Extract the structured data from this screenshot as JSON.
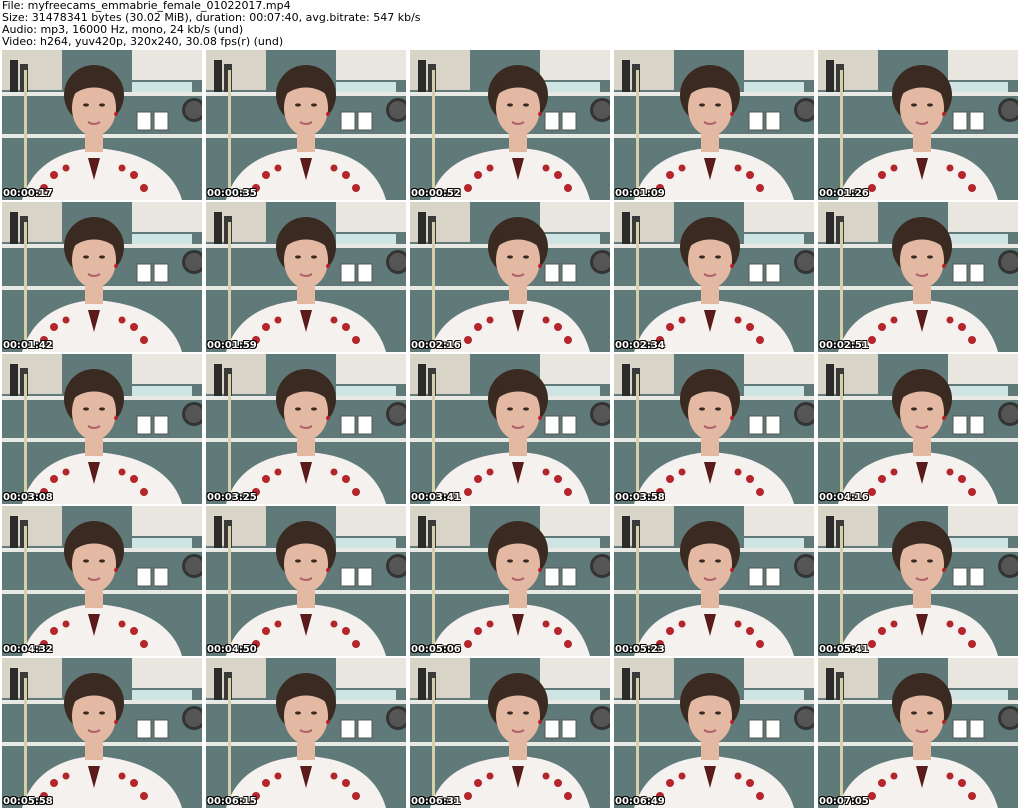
{
  "header": {
    "file": "File: myfreecams_emmabrie_female_01022017.mp4",
    "size": "Size: 31478341 bytes (30.02 MiB), duration: 00:07:40, avg.bitrate: 547 kb/s",
    "audio": "Audio: mp3, 16000 Hz, mono, 24 kb/s (und)",
    "video": "Video: h264, yuv420p, 320x240, 30.08 fps(r) (und)"
  },
  "thumbnails": [
    "00:00:17",
    "00:00:35",
    "00:00:52",
    "00:01:09",
    "00:01:26",
    "00:01:42",
    "00:01:59",
    "00:02:16",
    "00:02:34",
    "00:02:51",
    "00:03:08",
    "00:03:25",
    "00:03:41",
    "00:03:58",
    "00:04:16",
    "00:04:32",
    "00:04:50",
    "00:05:06",
    "00:05:23",
    "00:05:41",
    "00:05:58",
    "00:06:15",
    "00:06:31",
    "00:06:49",
    "00:07:05"
  ],
  "colors": {
    "wall": "#5f7a78",
    "shelf": "#e8e8e4",
    "blouse": "#f4f1ee",
    "embroidery": "#b3262b",
    "hair": "#3a2a22",
    "skin": "#e3b9a3"
  }
}
